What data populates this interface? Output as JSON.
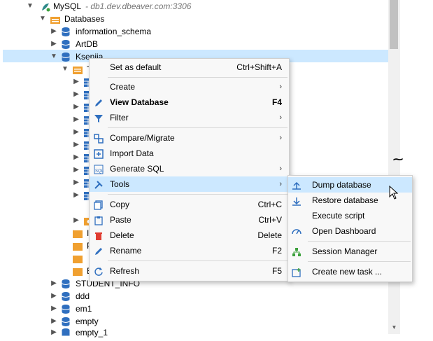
{
  "tree": {
    "connection": {
      "label": "MySQL",
      "host": "- db1.dev.dbeaver.com:3306"
    },
    "databases_label": "Databases",
    "items": [
      {
        "label": "information_schema"
      },
      {
        "label": "ArtDB"
      },
      {
        "label": "Ksenija"
      }
    ],
    "partial_labels": [
      "T",
      "V",
      "I",
      "P",
      "E"
    ],
    "bottom_items": [
      {
        "label": "STUDENT_INFO"
      },
      {
        "label": "ddd"
      },
      {
        "label": "em1"
      },
      {
        "label": "empty"
      },
      {
        "label": "empty_1"
      }
    ]
  },
  "context_menu": {
    "items": [
      {
        "label": "Set as default",
        "shortcut": "Ctrl+Shift+A",
        "icon": "none"
      },
      {
        "label": "Create",
        "submenu": "›",
        "icon": "none"
      },
      {
        "label": "View Database",
        "shortcut": "F4",
        "icon": "pencil-icon",
        "bold": true
      },
      {
        "label": "Filter",
        "submenu": "›",
        "icon": "filter-icon"
      },
      {
        "label": "Compare/Migrate",
        "submenu": "›",
        "icon": "compare-icon"
      },
      {
        "label": "Import Data",
        "icon": "import-icon"
      },
      {
        "label": "Generate SQL",
        "submenu": "›",
        "icon": "sql-icon"
      },
      {
        "label": "Tools",
        "submenu": "›",
        "icon": "tools-icon",
        "highlighted": true
      },
      {
        "label": "Copy",
        "shortcut": "Ctrl+C",
        "icon": "copy-icon"
      },
      {
        "label": "Paste",
        "shortcut": "Ctrl+V",
        "icon": "paste-icon"
      },
      {
        "label": "Delete",
        "shortcut": "Delete",
        "icon": "delete-icon"
      },
      {
        "label": "Rename",
        "shortcut": "F2",
        "icon": "rename-icon"
      },
      {
        "label": "Refresh",
        "shortcut": "F5",
        "icon": "refresh-icon"
      }
    ]
  },
  "tools_submenu": {
    "items": [
      {
        "label": "Dump database",
        "icon": "dump-icon",
        "highlighted": true
      },
      {
        "label": "Restore database",
        "icon": "restore-icon"
      },
      {
        "label": "Execute script",
        "icon": "none"
      },
      {
        "label": "Open Dashboard",
        "icon": "dashboard-icon"
      },
      {
        "label": "Session Manager",
        "icon": "session-icon"
      },
      {
        "label": "Create new task ...",
        "icon": "task-icon"
      }
    ]
  },
  "colors": {
    "selection": "#cce8ff",
    "db_icon": "#2f6fbf",
    "folder": "#f0a030",
    "accent": "#2f6fbf"
  }
}
